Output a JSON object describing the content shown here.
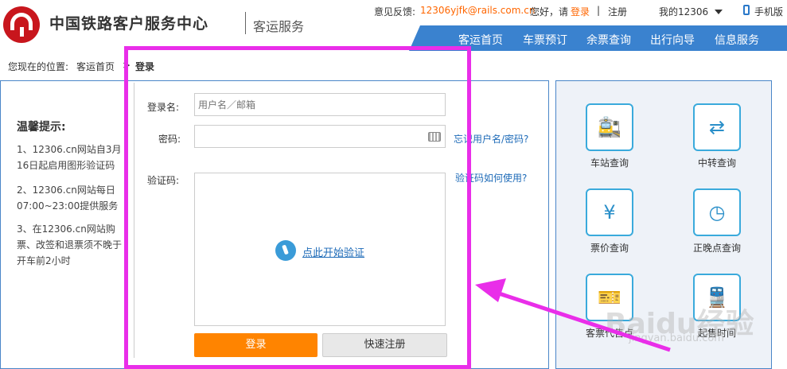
{
  "header": {
    "site_title": "中国铁路客户服务中心",
    "site_sub": "客运服务",
    "feedback_label": "意见反馈:",
    "feedback_email": "12306yjfk@rails.com.cn",
    "greeting": "您好，请",
    "login_link": "登录",
    "divider": "|",
    "register_link": "注册",
    "my_account": "我的12306",
    "mobile": "手机版"
  },
  "nav": {
    "items": [
      "客运首页",
      "车票预订",
      "余票查询",
      "出行向导",
      "信息服务"
    ]
  },
  "breadcrumb": {
    "prefix": "您现在的位置:",
    "home": "客运首页",
    "sep": ">",
    "current": "登录"
  },
  "tips": {
    "title": "温馨提示:",
    "items": [
      "1、12306.cn网站自3月16日起启用图形验证码",
      "2、12306.cn网站每日07:00~23:00提供服务",
      "3、在12306.cn网站购票、改签和退票须不晚于开车前2小时"
    ]
  },
  "login": {
    "username_label": "登录名:",
    "username_placeholder": "用户名／邮箱",
    "password_label": "密码:",
    "forgot_link": "忘记用户名/密码?",
    "captcha_label": "验证码:",
    "captcha_help": "验证码如何使用?",
    "captcha_start": "点此开始验证",
    "login_button": "登录",
    "register_button": "快速注册"
  },
  "services": {
    "items": [
      {
        "label": "车站查询",
        "icon": "station-icon",
        "glyph": "🚉"
      },
      {
        "label": "中转查询",
        "icon": "transfer-icon",
        "glyph": "⇄"
      },
      {
        "label": "票价查询",
        "icon": "fare-icon",
        "glyph": "¥"
      },
      {
        "label": "正晚点查询",
        "icon": "clock-icon",
        "glyph": "◷"
      },
      {
        "label": "客票代售点",
        "icon": "agency-icon",
        "glyph": "🎫"
      },
      {
        "label": "起售时间",
        "icon": "train-icon",
        "glyph": "🚆"
      }
    ]
  },
  "watermark": {
    "brand": "Baidu经验",
    "url": "jingyan.baidu.com"
  },
  "colors": {
    "accent": "#3a82cf",
    "orange": "#ff8400",
    "highlight": "#e92ee9",
    "logo_red": "#c8161d"
  }
}
